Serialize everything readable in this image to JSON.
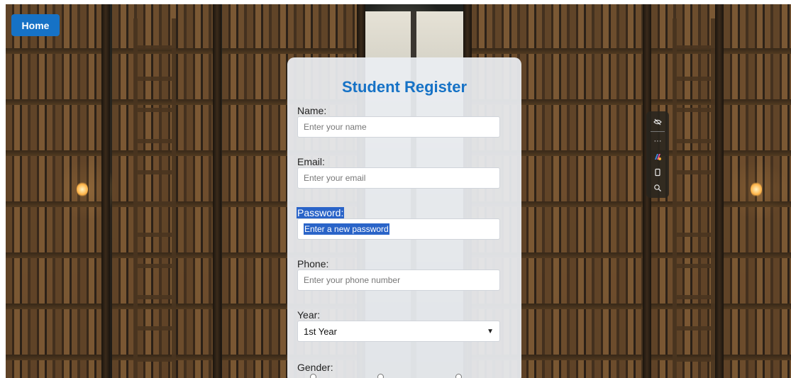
{
  "nav": {
    "home_label": "Home"
  },
  "form": {
    "title": "Student Register",
    "name": {
      "label": "Name:",
      "placeholder": "Enter your name"
    },
    "email": {
      "label": "Email:",
      "placeholder": "Enter your email"
    },
    "password": {
      "label": "Password:",
      "placeholder": "Enter a new password"
    },
    "phone": {
      "label": "Phone:",
      "placeholder": "Enter your phone number"
    },
    "year": {
      "label": "Year:",
      "selected": "1st Year"
    },
    "gender": {
      "label": "Gender:"
    }
  },
  "floating_toolbar": {
    "icons": [
      "hide-icon",
      "more-icon",
      "copilot-icon",
      "copy-icon",
      "search-icon"
    ],
    "more_glyph": "···"
  },
  "colors": {
    "accent": "#1672c6",
    "selection": "#2a64c8"
  }
}
